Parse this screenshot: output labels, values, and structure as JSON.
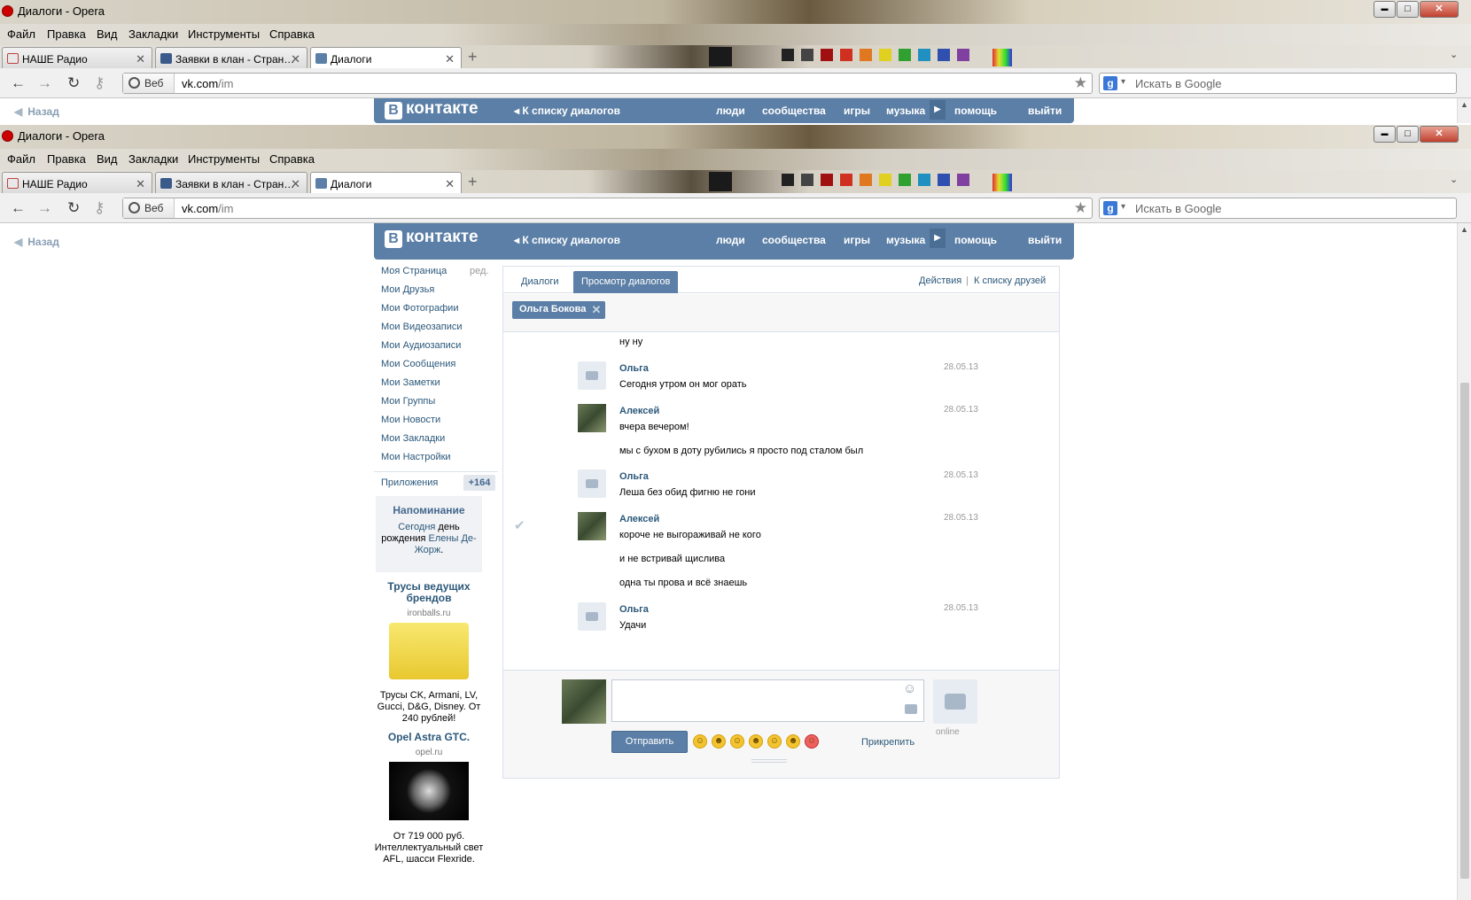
{
  "window": {
    "title": "Диалоги - Opera",
    "min": "▬",
    "max": "□",
    "close": "✕"
  },
  "menu": [
    "Файл",
    "Правка",
    "Вид",
    "Закладки",
    "Инструменты",
    "Справка"
  ],
  "tabs": [
    {
      "label": "НАШЕ Радио",
      "close": "✕"
    },
    {
      "label": "Заявки в клан - Стран…",
      "close": "✕"
    },
    {
      "label": "Диалоги",
      "close": "✕"
    }
  ],
  "new_tab": "+",
  "address": {
    "web_label": "Веб",
    "url_host": "vk.com",
    "url_path": "/im",
    "star": "★"
  },
  "search": {
    "engine": "g",
    "placeholder": "Искать в Google"
  },
  "page": {
    "back": "Назад",
    "header": {
      "logo_b": "В",
      "logo_text": "контакте",
      "back_to_dialogs": "К списку диалогов",
      "nav": [
        "люди",
        "сообщества",
        "игры",
        "музыка",
        "помощь",
        "выйти"
      ]
    },
    "left_menu": {
      "items": [
        "Моя Страница",
        "Мои Друзья",
        "Мои Фотографии",
        "Мои Видеозаписи",
        "Мои Аудиозаписи",
        "Мои Сообщения",
        "Мои Заметки",
        "Мои Группы",
        "Мои Новости",
        "Мои Закладки",
        "Мои Настройки"
      ],
      "edit": "ред.",
      "apps": "Приложения",
      "apps_badge": "+164"
    },
    "reminder": {
      "title": "Напоминание",
      "today": "Сегодня",
      "text1": " день рождения ",
      "name": "Елены Де-Жорж",
      "dot": "."
    },
    "ads": [
      {
        "title": "Трусы ведущих брендов",
        "domain": "ironballs.ru",
        "text": "Трусы CK, Armani, LV, Gucci, D&G, Disney. От 240 рублей!"
      },
      {
        "title": "Opel Astra GTC.",
        "domain": "opel.ru",
        "text": "От 719 000 руб. Интеллектуальный свет AFL, шасси Flexride."
      }
    ],
    "dialog": {
      "tabs": [
        "Диалоги",
        "Просмотр диалогов"
      ],
      "actions": "Действия",
      "separator": "|",
      "friends": "К списку друзей",
      "peer": "Ольга Бокова",
      "peer_close": "✕",
      "messages": [
        {
          "text": "ну ну"
        },
        {
          "author": "Ольга",
          "date": "28.05.13",
          "text": "Сегодня утром он мог орать"
        },
        {
          "author": "Алексей",
          "date": "28.05.13",
          "text": "вчера вечером!"
        },
        {
          "text": "мы с бухом в доту рубились я просто под сталом был"
        },
        {
          "author": "Ольга",
          "date": "28.05.13",
          "text": "Леша без обид фигню не гони"
        },
        {
          "author": "Алексей",
          "date": "28.05.13",
          "text": "короче не выгораживай не кого",
          "check": "✔"
        },
        {
          "text": "и не встривай щислива"
        },
        {
          "text": "одна ты прова и всё знаешь"
        },
        {
          "author": "Ольга",
          "date": "28.05.13",
          "text": "Удачи"
        }
      ],
      "compose": {
        "send": "Отправить",
        "attach": "Прикрепить",
        "online": "online",
        "smile_icon": "☺",
        "emoji": [
          "☺",
          "☻",
          "☺",
          "☻",
          "☺",
          "☻",
          "☺"
        ]
      }
    }
  }
}
